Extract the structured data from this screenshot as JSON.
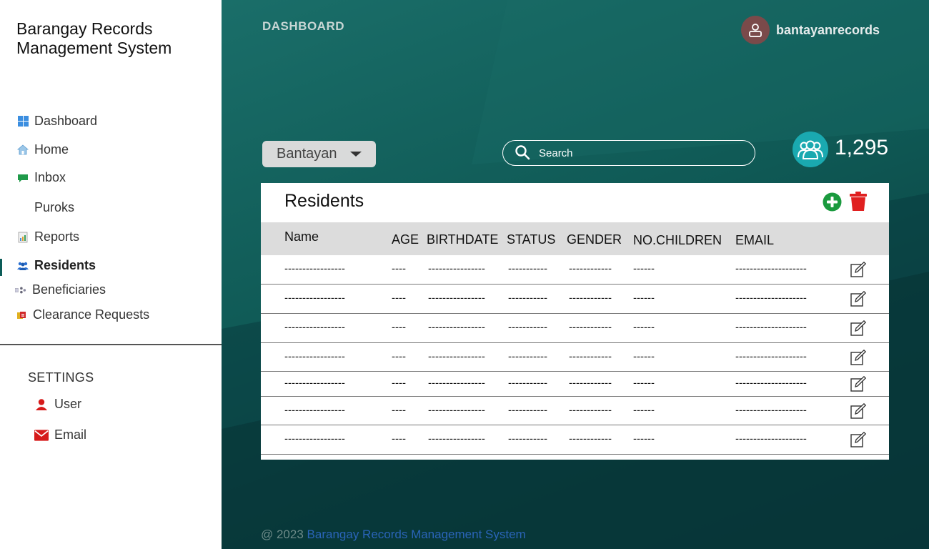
{
  "app": {
    "title": "Barangay Records Management System"
  },
  "sidebar": {
    "items": [
      {
        "label": "Dashboard",
        "icon": "dashboard-grid-icon"
      },
      {
        "label": "Home",
        "icon": "home-icon"
      },
      {
        "label": "Inbox",
        "icon": "chat-bubble-icon"
      },
      {
        "label": "Puroks",
        "icon": ""
      },
      {
        "label": "Reports",
        "icon": "report-document-icon"
      },
      {
        "label": "Residents",
        "icon": "people-icon",
        "active": true
      },
      {
        "label": "Beneficiaries",
        "icon": "beneficiaries-icon"
      },
      {
        "label": "Clearance Requests",
        "icon": "clearance-icon"
      }
    ],
    "settings_title": "SETTINGS",
    "settings_items": [
      {
        "label": "User",
        "icon": "user-icon"
      },
      {
        "label": "Email",
        "icon": "envelope-icon"
      }
    ]
  },
  "header": {
    "page_label": "DASHBOARD",
    "username": "bantayanrecords"
  },
  "filters": {
    "barangay_selected": "Bantayan",
    "search_placeholder": "Search"
  },
  "stats": {
    "resident_count": "1,295"
  },
  "residents_table": {
    "title": "Residents",
    "columns": [
      "Name",
      "AGE",
      "BIRTHDATE",
      "STATUS",
      "GENDER",
      "NO.CHILDREN",
      "EMAIL"
    ],
    "rows": [
      [
        "-----------------",
        "----",
        "----------------",
        "-----------",
        "------------",
        "------",
        "--------------------"
      ],
      [
        "-----------------",
        "----",
        "----------------",
        "-----------",
        "------------",
        "------",
        "--------------------"
      ],
      [
        "-----------------",
        "----",
        "----------------",
        "-----------",
        "------------",
        "------",
        "--------------------"
      ],
      [
        "-----------------",
        "----",
        "----------------",
        "-----------",
        "------------",
        "------",
        "--------------------"
      ],
      [
        "-----------------",
        "----",
        "----------------",
        "-----------",
        "------------",
        "------",
        "--------------------"
      ],
      [
        "-----------------",
        "----",
        "----------------",
        "-----------",
        "------------",
        "------",
        "--------------------"
      ],
      [
        "-----------------",
        "----",
        "----------------",
        "-----------",
        "------------",
        "------",
        "--------------------"
      ]
    ]
  },
  "footer": {
    "prefix": "@ 2023",
    "link": "Barangay Records Management System"
  },
  "colors": {
    "brand_teal": "#0f5955",
    "add_green": "#1a9a3e",
    "delete_red": "#e02020",
    "count_badge": "#1aa9b0"
  }
}
